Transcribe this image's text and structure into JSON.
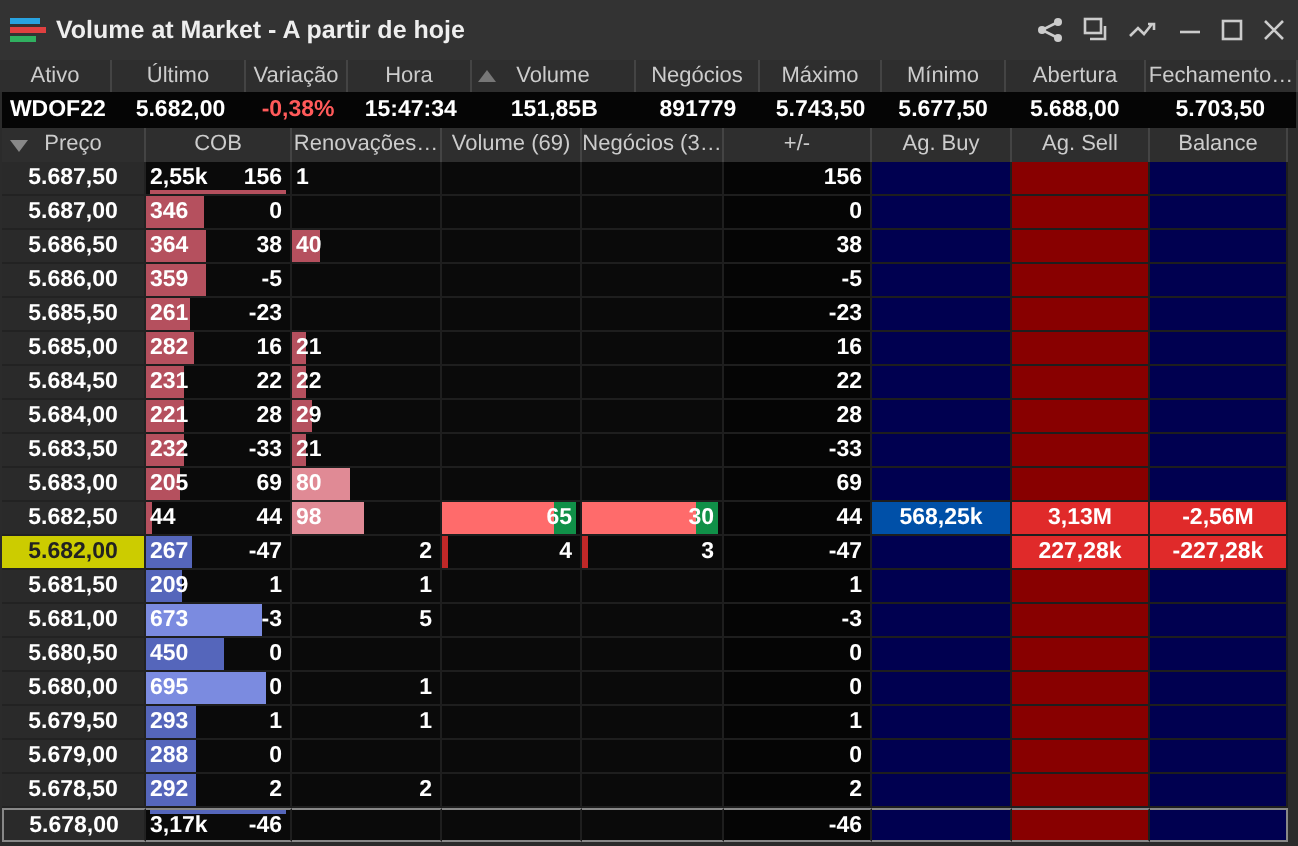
{
  "window": {
    "title": "Volume at Market - A partir de hoje"
  },
  "quote": {
    "columns": [
      {
        "label": "Ativo",
        "sorted": false
      },
      {
        "label": "Último",
        "sorted": false
      },
      {
        "label": "Variação",
        "sorted": false
      },
      {
        "label": "Hora",
        "sorted": false
      },
      {
        "label": "Volume",
        "sorted": true
      },
      {
        "label": "Negócios",
        "sorted": false
      },
      {
        "label": "Máximo",
        "sorted": false
      },
      {
        "label": "Mínimo",
        "sorted": false
      },
      {
        "label": "Abertura",
        "sorted": false
      },
      {
        "label": "Fechamento…",
        "sorted": false
      }
    ],
    "values": [
      {
        "text": "WDOF22",
        "kind": "plain"
      },
      {
        "text": "5.682,00",
        "kind": "plain"
      },
      {
        "text": "-0,38%",
        "kind": "down"
      },
      {
        "text": "15:47:34",
        "kind": "plain"
      },
      {
        "text": "151,85B",
        "kind": "plain"
      },
      {
        "text": "891779",
        "kind": "plain"
      },
      {
        "text": "5.743,50",
        "kind": "plain"
      },
      {
        "text": "5.677,50",
        "kind": "plain"
      },
      {
        "text": "5.688,00",
        "kind": "plain"
      },
      {
        "text": "5.703,50",
        "kind": "plain"
      }
    ]
  },
  "table": {
    "columns": [
      "Preço",
      "COB",
      "Renovações…",
      "Volume (69)",
      "Negócios (3…",
      "+/-",
      "Ag. Buy",
      "Ag. Sell",
      "Balance"
    ],
    "rows": [
      {
        "price": "5.687,50",
        "selected": false,
        "current": false,
        "kind": "total",
        "cob": {
          "value": "2,55k",
          "delta": "156",
          "kind": "ask",
          "level": 1
        },
        "renew": {
          "value": "1",
          "kind": "ask"
        },
        "pm": "156"
      },
      {
        "price": "5.687,00",
        "selected": false,
        "current": false,
        "kind": "level",
        "cob": {
          "value": "346",
          "delta": "0",
          "kind": "ask",
          "level": 0.4
        },
        "pm": "0"
      },
      {
        "price": "5.686,50",
        "selected": false,
        "current": false,
        "kind": "level",
        "cob": {
          "value": "364",
          "delta": "38",
          "kind": "ask",
          "level": 0.42
        },
        "renew": {
          "value": "40",
          "kind": "ask",
          "level": 0.19
        },
        "pm": "38"
      },
      {
        "price": "5.686,00",
        "selected": false,
        "current": false,
        "kind": "level",
        "cob": {
          "value": "359",
          "delta": "-5",
          "kind": "ask",
          "level": 0.42
        },
        "pm": "-5"
      },
      {
        "price": "5.685,50",
        "selected": false,
        "current": false,
        "kind": "level",
        "cob": {
          "value": "261",
          "delta": "-23",
          "kind": "ask",
          "level": 0.31
        },
        "pm": "-23"
      },
      {
        "price": "5.685,00",
        "selected": false,
        "current": false,
        "kind": "level",
        "cob": {
          "value": "282",
          "delta": "16",
          "kind": "ask",
          "level": 0.33
        },
        "renew": {
          "value": "21",
          "kind": "ask",
          "level": 0.09
        },
        "pm": "16"
      },
      {
        "price": "5.684,50",
        "selected": false,
        "current": false,
        "kind": "level",
        "cob": {
          "value": "231",
          "delta": "22",
          "kind": "ask",
          "level": 0.27
        },
        "renew": {
          "value": "22",
          "kind": "ask",
          "level": 0.09
        },
        "pm": "22"
      },
      {
        "price": "5.684,00",
        "selected": false,
        "current": false,
        "kind": "level",
        "cob": {
          "value": "221",
          "delta": "28",
          "kind": "ask",
          "level": 0.26
        },
        "renew": {
          "value": "29",
          "kind": "ask",
          "level": 0.13
        },
        "pm": "28"
      },
      {
        "price": "5.683,50",
        "selected": false,
        "current": false,
        "kind": "level",
        "cob": {
          "value": "232",
          "delta": "-33",
          "kind": "ask",
          "level": 0.27
        },
        "renew": {
          "value": "21",
          "kind": "ask",
          "level": 0.09
        },
        "pm": "-33"
      },
      {
        "price": "5.683,00",
        "selected": false,
        "current": false,
        "kind": "level",
        "cob": {
          "value": "205",
          "delta": "69",
          "kind": "ask",
          "level": 0.24
        },
        "renew": {
          "value": "80",
          "kind": "ask",
          "level": 0.39
        },
        "pm": "69"
      },
      {
        "price": "5.682,50",
        "selected": false,
        "current": false,
        "kind": "level",
        "cob": {
          "value": "44",
          "delta": "44",
          "kind": "ask",
          "level": 0.04
        },
        "renew": {
          "value": "98",
          "kind": "ask",
          "level": 0.48
        },
        "volume": {
          "value": "65",
          "sell": {
            "level": 0.81
          },
          "buy": {
            "level": 0.16
          }
        },
        "trades": {
          "value": "30",
          "sell": {
            "level": 0.81
          },
          "buy": {
            "level": 0.16
          }
        },
        "pm": "44",
        "ag_buy": "568,25k",
        "ag_sell": "3,13M",
        "balance": "-2,56M"
      },
      {
        "price": "5.682,00",
        "selected": true,
        "current": false,
        "kind": "level",
        "cob": {
          "value": "267",
          "delta": "-47",
          "kind": "bid",
          "level": 0.32
        },
        "renew": {
          "value": "2",
          "kind": "bid"
        },
        "volume": {
          "value": "4",
          "sell": {
            "level": 0.04
          }
        },
        "trades": {
          "value": "3",
          "sell": {
            "level": 0.04
          }
        },
        "pm": "-47",
        "ag_sell": "227,28k",
        "balance": "-227,28k"
      },
      {
        "price": "5.681,50",
        "selected": false,
        "current": false,
        "kind": "level",
        "cob": {
          "value": "209",
          "delta": "1",
          "kind": "bid",
          "level": 0.25
        },
        "renew": {
          "value": "1",
          "kind": "bid"
        },
        "pm": "1"
      },
      {
        "price": "5.681,00",
        "selected": false,
        "current": false,
        "kind": "level",
        "cob": {
          "value": "673",
          "delta": "-3",
          "kind": "bid",
          "level": 0.81
        },
        "renew": {
          "value": "5",
          "kind": "bid"
        },
        "pm": "-3"
      },
      {
        "price": "5.680,50",
        "selected": false,
        "current": false,
        "kind": "level",
        "cob": {
          "value": "450",
          "delta": "0",
          "kind": "bid",
          "level": 0.54
        },
        "pm": "0"
      },
      {
        "price": "5.680,00",
        "selected": false,
        "current": false,
        "kind": "level",
        "cob": {
          "value": "695",
          "delta": "0",
          "kind": "bid",
          "level": 0.84
        },
        "renew": {
          "value": "1",
          "kind": "bid"
        },
        "pm": "0"
      },
      {
        "price": "5.679,50",
        "selected": false,
        "current": false,
        "kind": "level",
        "cob": {
          "value": "293",
          "delta": "1",
          "kind": "bid",
          "level": 0.35
        },
        "renew": {
          "value": "1",
          "kind": "bid"
        },
        "pm": "1"
      },
      {
        "price": "5.679,00",
        "selected": false,
        "current": false,
        "kind": "level",
        "cob": {
          "value": "288",
          "delta": "0",
          "kind": "bid",
          "level": 0.35
        },
        "pm": "0"
      },
      {
        "price": "5.678,50",
        "selected": false,
        "current": false,
        "kind": "level",
        "cob": {
          "value": "292",
          "delta": "2",
          "kind": "bid",
          "level": 0.35
        },
        "renew": {
          "value": "2",
          "kind": "bid"
        },
        "pm": "2"
      },
      {
        "price": "5.678,00",
        "selected": false,
        "current": true,
        "kind": "total",
        "cob": {
          "value": "3,17k",
          "delta": "-46",
          "kind": "bid",
          "level": 1
        },
        "pm": "-46"
      }
    ]
  }
}
